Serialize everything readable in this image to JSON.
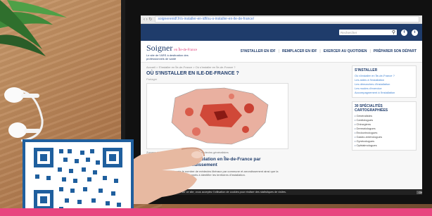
{
  "browser": {
    "nav_glyphs": "‹ › ↻",
    "url": "soignerenidf.fr/s-installer-en-idf/ou-s-installer-en-ile-de-france/"
  },
  "site": {
    "search_placeholder": "Rechercher",
    "social": [
      "f",
      "t"
    ],
    "logo_main": "Soigner",
    "logo_sub": "en Île-de-France",
    "logo_tagline": "Le site de l'ARS à destination des professionnels de santé",
    "menu": [
      "S'INSTALLER EN IDF",
      "REMPLACER EN IDF",
      "EXERCER AU QUOTIDIEN",
      "PRÉPARER SON DÉPART"
    ]
  },
  "page": {
    "breadcrumb": "Accueil > S'installer en Île-de-France > Où s'installer en Île-de-France ?",
    "title": "OÙ S'INSTALLER EN ILE-DE-FRANCE ?",
    "share": "Partager",
    "map_caption": "Zonage de la région Île-de-France pour les médecins généralistes",
    "section_title": "Médecins libéraux et population en Île-de-France par commune et par arrondissement",
    "section_text": "Cette cartographie présente le nombre de médecins libéraux par commune et arrondissement ainsi que la population, afin d'aider les professionnels à identifier les territoires d'installation."
  },
  "sidebar": {
    "install_title": "S'INSTALLER",
    "install_links": [
      "Où s'installer en Île-de-France ?",
      "Les aides à l'installation",
      "Les démarches d'installation",
      "Les modes d'exercice",
      "Accompagnement à l'installation"
    ],
    "carto_title": "30 SPÉCIALITÉS CARTOGRAPHIÉES",
    "carto_items": [
      "Généralistes",
      "Cardiologues",
      "Chirurgiens",
      "Dermatologues",
      "Endocrinologues",
      "Gastro-entérologues",
      "Gynécologues",
      "Ophtalmologues"
    ]
  },
  "cookie": {
    "text": "En poursuivant votre navigation sur ce site, vous acceptez l'utilisation de cookies pour réaliser des statistiques de visites.",
    "ok": "OK"
  },
  "colors": {
    "site_blue": "#1f3c6b",
    "accent_pink": "#e8457f",
    "qr_frame_blue": "#1f5f9e"
  }
}
